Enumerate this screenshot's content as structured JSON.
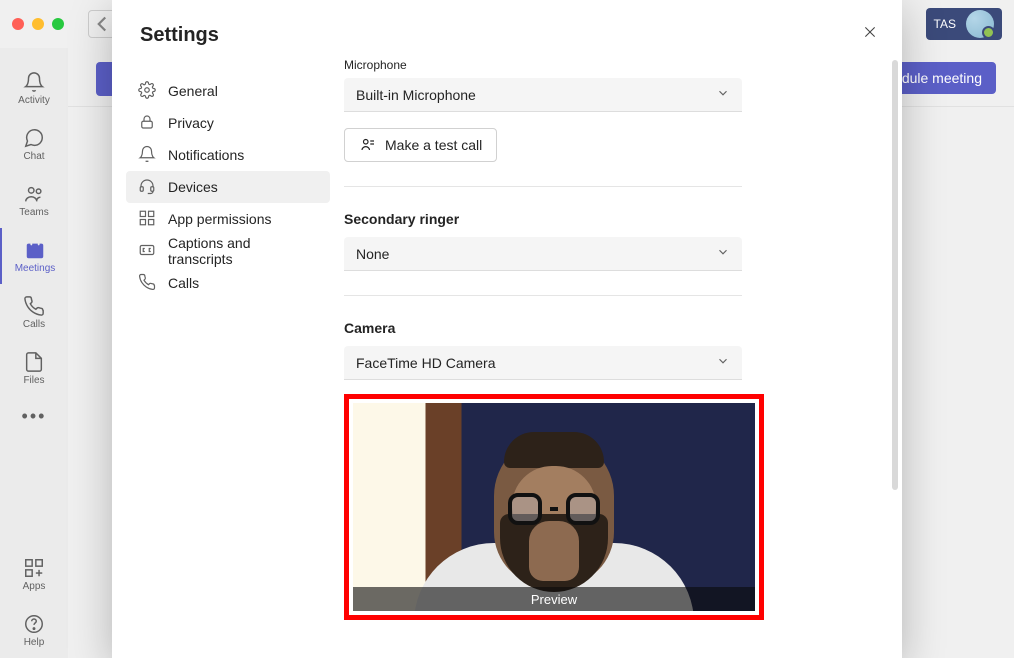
{
  "window": {
    "back_enabled": false,
    "user_initials": "TAS"
  },
  "rail": {
    "items": [
      {
        "id": "activity",
        "label": "Activity"
      },
      {
        "id": "chat",
        "label": "Chat"
      },
      {
        "id": "teams",
        "label": "Teams"
      },
      {
        "id": "meetings",
        "label": "Meetings",
        "active": true
      },
      {
        "id": "calls",
        "label": "Calls"
      },
      {
        "id": "files",
        "label": "Files"
      }
    ],
    "bottom": [
      {
        "id": "apps",
        "label": "Apps"
      },
      {
        "id": "help",
        "label": "Help"
      }
    ]
  },
  "background": {
    "schedule_button": "dule meeting"
  },
  "settings": {
    "title": "Settings",
    "nav": [
      {
        "id": "general",
        "label": "General"
      },
      {
        "id": "privacy",
        "label": "Privacy"
      },
      {
        "id": "notifications",
        "label": "Notifications"
      },
      {
        "id": "devices",
        "label": "Devices",
        "active": true
      },
      {
        "id": "app_permissions",
        "label": "App permissions"
      },
      {
        "id": "captions",
        "label": "Captions and transcripts"
      },
      {
        "id": "calls",
        "label": "Calls"
      }
    ],
    "devices": {
      "microphone": {
        "label": "Microphone",
        "value": "Built-in Microphone",
        "test_call_label": "Make a test call"
      },
      "secondary_ringer": {
        "label": "Secondary ringer",
        "value": "None"
      },
      "camera": {
        "label": "Camera",
        "value": "FaceTime HD Camera",
        "preview_label": "Preview"
      }
    }
  }
}
